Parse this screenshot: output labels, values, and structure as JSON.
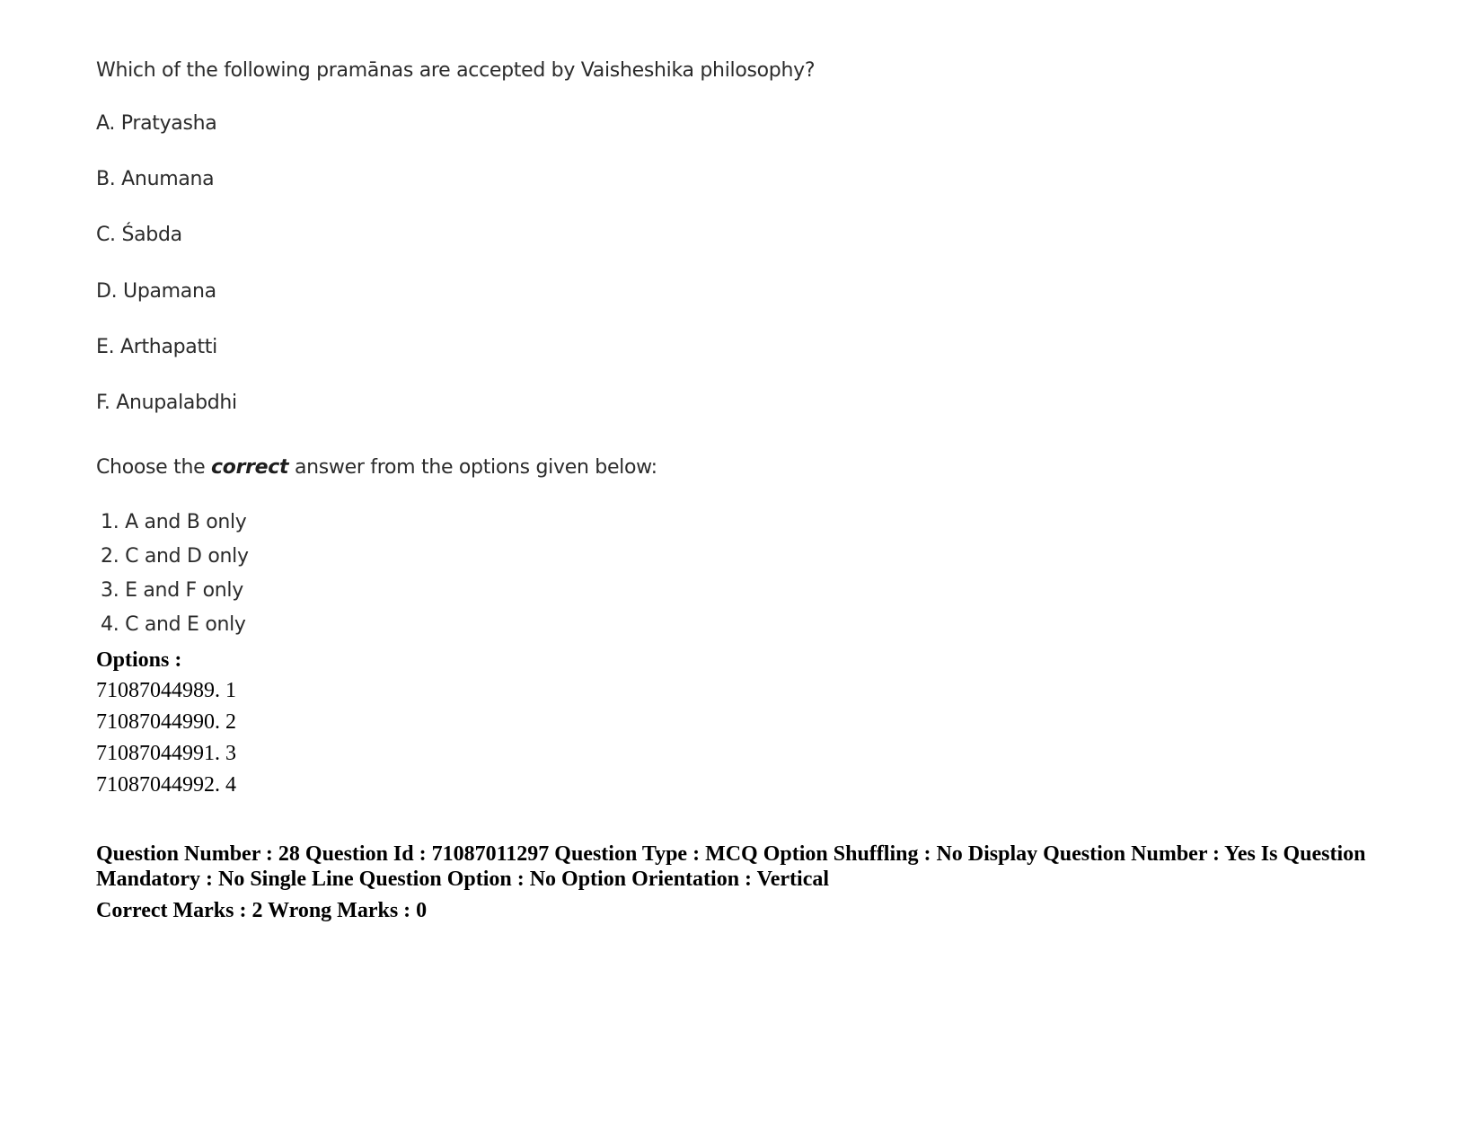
{
  "question": {
    "text": "Which of the following pramānas are accepted by Vaisheshika philosophy?",
    "statements": [
      {
        "label": "A. Pratyasha"
      },
      {
        "label": "B. Anumana"
      },
      {
        "label": "C. Śabda"
      },
      {
        "label": "D. Upamana"
      },
      {
        "label": "E. Arthapatti"
      },
      {
        "label": "F. Anupalabdhi"
      }
    ],
    "instruction": {
      "prefix": "Choose the ",
      "emphasis": "correct",
      "suffix": " answer from the options given below:"
    },
    "answers": [
      {
        "label": "1. A and B only"
      },
      {
        "label": "2. C and D only"
      },
      {
        "label": "3. E and F only"
      },
      {
        "label": "4. C and E only"
      }
    ]
  },
  "options": {
    "heading": "Options :",
    "items": [
      {
        "label": "71087044989. 1"
      },
      {
        "label": "71087044990. 2"
      },
      {
        "label": "71087044991. 3"
      },
      {
        "label": "71087044992. 4"
      }
    ]
  },
  "meta": {
    "line1": "Question Number : 28 Question Id : 71087011297 Question Type : MCQ Option Shuffling : No Display Question Number : Yes Is Question Mandatory : No Single Line Question Option : No Option Orientation : Vertical",
    "marks": "Correct Marks : 2 Wrong Marks : 0"
  }
}
